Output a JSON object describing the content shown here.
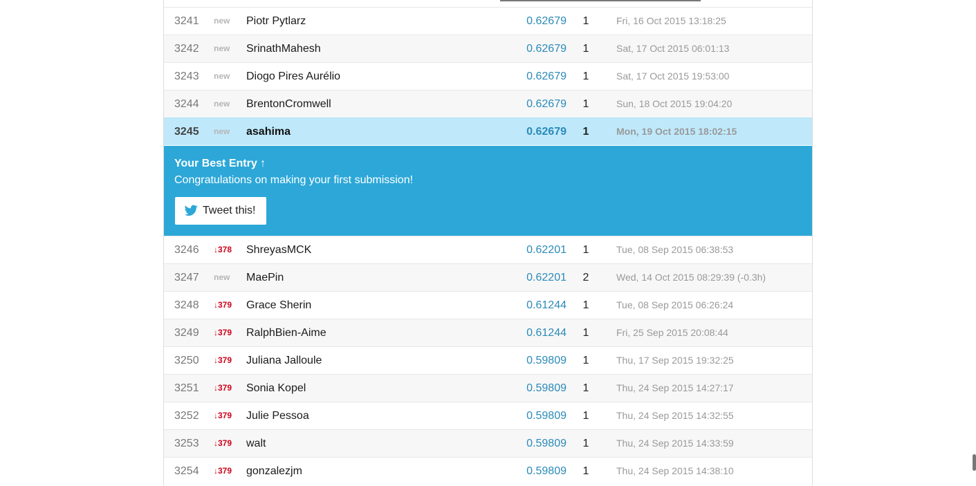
{
  "leaderboard": {
    "rows_before": [
      {
        "rank": "3241",
        "delta": "new",
        "delta_type": "new",
        "team": "Piotr Pytlarz",
        "score": "0.62679",
        "entries": "1",
        "last": "Fri, 16 Oct 2015 13:18:25"
      },
      {
        "rank": "3242",
        "delta": "new",
        "delta_type": "new",
        "team": "SrinathMahesh",
        "score": "0.62679",
        "entries": "1",
        "last": "Sat, 17 Oct 2015 06:01:13"
      },
      {
        "rank": "3243",
        "delta": "new",
        "delta_type": "new",
        "team": "Diogo Pires Aurélio",
        "score": "0.62679",
        "entries": "1",
        "last": "Sat, 17 Oct 2015 19:53:00"
      },
      {
        "rank": "3244",
        "delta": "new",
        "delta_type": "new",
        "team": "BrentonCromwell",
        "score": "0.62679",
        "entries": "1",
        "last": "Sun, 18 Oct 2015 19:04:20"
      }
    ],
    "my_row": {
      "rank": "3245",
      "delta": "new",
      "delta_type": "new",
      "team": "asahima",
      "score": "0.62679",
      "entries": "1",
      "last": "Mon, 19 Oct 2015 18:02:15"
    },
    "best_entry": {
      "title": "Your Best Entry ↑",
      "message": "Congratulations on making your first submission!",
      "tweet_label": "Tweet this!",
      "tweet_icon": "twitter-bird-icon"
    },
    "rows_after": [
      {
        "rank": "3246",
        "delta": "↓378",
        "delta_type": "down",
        "team": "ShreyasMCK",
        "score": "0.62201",
        "entries": "1",
        "last": "Tue, 08 Sep 2015 06:38:53"
      },
      {
        "rank": "3247",
        "delta": "new",
        "delta_type": "new",
        "team": "MaePin",
        "score": "0.62201",
        "entries": "2",
        "last": "Wed, 14 Oct 2015 08:29:39 (-0.3h)"
      },
      {
        "rank": "3248",
        "delta": "↓379",
        "delta_type": "down",
        "team": "Grace Sherin",
        "score": "0.61244",
        "entries": "1",
        "last": "Tue, 08 Sep 2015 06:26:24"
      },
      {
        "rank": "3249",
        "delta": "↓379",
        "delta_type": "down",
        "team": "RalphBien-Aime",
        "score": "0.61244",
        "entries": "1",
        "last": "Fri, 25 Sep 2015 20:08:44"
      },
      {
        "rank": "3250",
        "delta": "↓379",
        "delta_type": "down",
        "team": "Juliana Jalloule",
        "score": "0.59809",
        "entries": "1",
        "last": "Thu, 17 Sep 2015 19:32:25"
      },
      {
        "rank": "3251",
        "delta": "↓379",
        "delta_type": "down",
        "team": "Sonia Kopel",
        "score": "0.59809",
        "entries": "1",
        "last": "Thu, 24 Sep 2015 14:27:17"
      },
      {
        "rank": "3252",
        "delta": "↓379",
        "delta_type": "down",
        "team": "Julie Pessoa",
        "score": "0.59809",
        "entries": "1",
        "last": "Thu, 24 Sep 2015 14:32:55"
      },
      {
        "rank": "3253",
        "delta": "↓379",
        "delta_type": "down",
        "team": "walt",
        "score": "0.59809",
        "entries": "1",
        "last": "Thu, 24 Sep 2015 14:33:59"
      },
      {
        "rank": "3254",
        "delta": "↓379",
        "delta_type": "down",
        "team": "gonzalezjm",
        "score": "0.59809",
        "entries": "1",
        "last": "Thu, 24 Sep 2015 14:38:10"
      }
    ]
  },
  "colors": {
    "highlight_row": "#bfe9fb",
    "banner": "#2ca7d8",
    "score": "#2a8ab8",
    "delta_down": "#d0021b",
    "delta_new": "#b5b5b5"
  }
}
